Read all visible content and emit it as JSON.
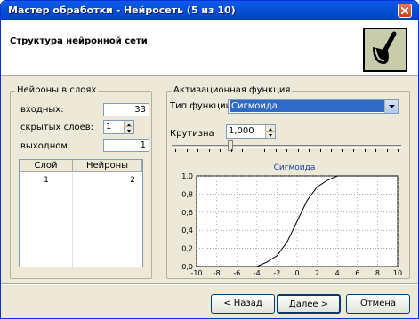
{
  "window": {
    "title": "Мастер обработки - Нейросеть (5 из 10)"
  },
  "header": {
    "title": "Структура нейронной сети",
    "icon": "pipe-logo-icon"
  },
  "neurons_group": {
    "label": "Нейроны в слоях",
    "inputs_label": "входных:",
    "inputs_value": "33",
    "hidden_layers_label": "скрытых слоев:",
    "hidden_layers_value": "1",
    "outputs_label": "выходном",
    "outputs_value": "1",
    "table": {
      "columns": [
        "Слой",
        "Нейроны"
      ],
      "rows": [
        [
          "1",
          "2"
        ]
      ]
    }
  },
  "activation_group": {
    "label": "Активационная функция",
    "type_label": "Тип функции",
    "type_value": "Сигмоида",
    "steepness_label": "Крутизна",
    "steepness_value": "1,000",
    "chart_title": "Сигмоида"
  },
  "chart_data": {
    "type": "line",
    "title": "Сигмоида",
    "xlabel": "",
    "ylabel": "",
    "xlim": [
      -10,
      10
    ],
    "ylim": [
      0,
      1
    ],
    "x_ticks": [
      "-10",
      "-8",
      "-6",
      "-4",
      "-2",
      "0",
      "2",
      "4",
      "6",
      "8",
      "10"
    ],
    "y_ticks": [
      "0,0",
      "0,2",
      "0,4",
      "0,6",
      "0,8",
      "1,0"
    ],
    "grid": true,
    "series": [
      {
        "x": [
          -10,
          -9,
          -8,
          -7,
          -6,
          -5,
          -4,
          -3,
          -2,
          -1,
          0,
          1,
          2,
          3,
          4,
          5,
          6,
          7,
          8,
          9,
          10
        ],
        "y": [
          0,
          0,
          0,
          0,
          0,
          0,
          0.0,
          0.05,
          0.12,
          0.27,
          0.5,
          0.73,
          0.88,
          0.95,
          1.0,
          1.0,
          1.0,
          1.0,
          1.0,
          1.0,
          1.0
        ]
      }
    ],
    "colors": {
      "line": "#000000",
      "grid": "#7f7f7f",
      "title": "#1f3f9f"
    }
  },
  "buttons": {
    "back": "< Назад",
    "next": "Далее >",
    "cancel": "Отмена"
  }
}
